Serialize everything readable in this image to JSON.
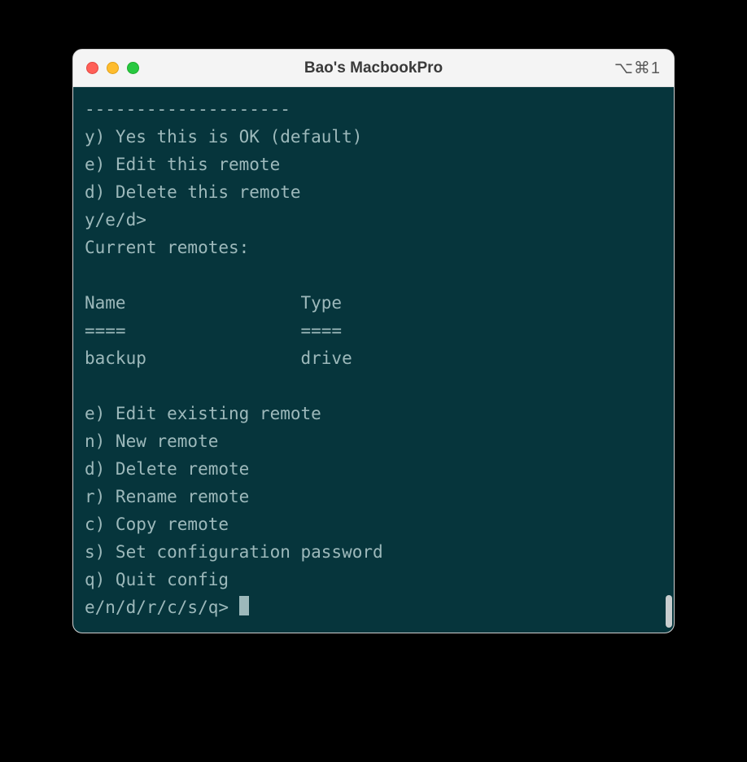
{
  "window": {
    "title": "Bao's MacbookPro",
    "shortcut": "⌥⌘1"
  },
  "terminal": {
    "lines": [
      "--------------------",
      "y) Yes this is OK (default)",
      "e) Edit this remote",
      "d) Delete this remote",
      "y/e/d>",
      "Current remotes:",
      "",
      "Name                 Type",
      "====                 ====",
      "backup               drive",
      "",
      "e) Edit existing remote",
      "n) New remote",
      "d) Delete remote",
      "r) Rename remote",
      "c) Copy remote",
      "s) Set configuration password",
      "q) Quit config"
    ],
    "prompt": "e/n/d/r/c/s/q> "
  }
}
